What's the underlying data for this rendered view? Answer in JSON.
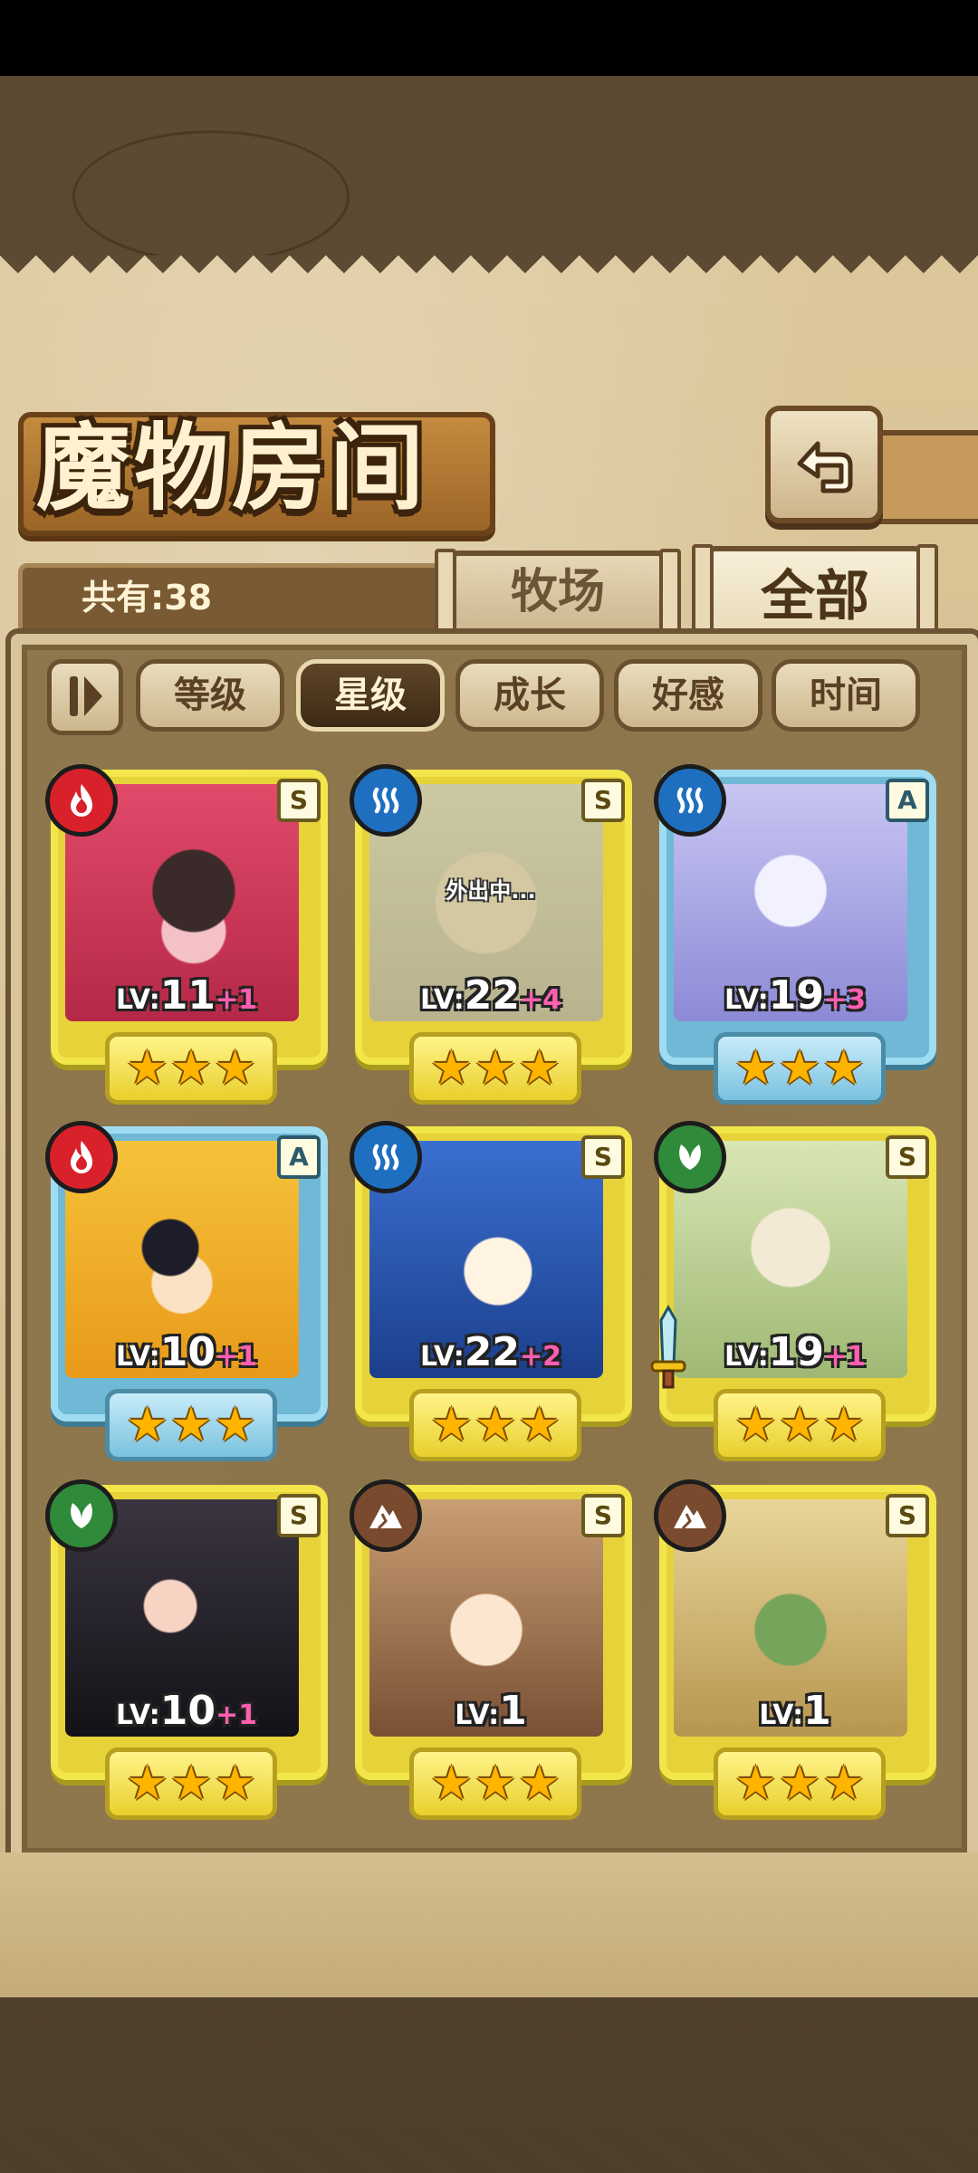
{
  "header": {
    "title": "魔物房间",
    "count_label": "共有:38"
  },
  "tabs": [
    {
      "label": "牧场",
      "selected": false
    },
    {
      "label": "全部",
      "selected": true
    }
  ],
  "sort": {
    "buttons": [
      {
        "label": "等级",
        "active": false
      },
      {
        "label": "星级",
        "active": true
      },
      {
        "label": "成长",
        "active": false
      },
      {
        "label": "好感",
        "active": false
      },
      {
        "label": "时间",
        "active": false
      }
    ]
  },
  "colors": {
    "fire": "#d8212a",
    "water": "#1f6fc0",
    "nature": "#2f8a3a",
    "earth": "#7a4a2e",
    "plus_pink": "#ff5fb0"
  },
  "monsters": [
    {
      "element": "fire-icon",
      "tier": "S",
      "lv_prefix": "LV:",
      "level": "11",
      "plus": "+1",
      "stars": 3,
      "frame": "gold",
      "status": ""
    },
    {
      "element": "water-icon",
      "tier": "S",
      "lv_prefix": "LV:",
      "level": "22",
      "plus": "+4",
      "stars": 3,
      "frame": "gold",
      "status": "外出中..."
    },
    {
      "element": "water-icon",
      "tier": "A",
      "lv_prefix": "LV:",
      "level": "19",
      "plus": "+3",
      "stars": 3,
      "frame": "blue",
      "status": ""
    },
    {
      "element": "fire-icon",
      "tier": "A",
      "lv_prefix": "LV:",
      "level": "10",
      "plus": "+1",
      "stars": 3,
      "frame": "blue",
      "status": ""
    },
    {
      "element": "water-icon",
      "tier": "S",
      "lv_prefix": "LV:",
      "level": "22",
      "plus": "+2",
      "stars": 3,
      "frame": "gold",
      "status": ""
    },
    {
      "element": "nature-icon",
      "tier": "S",
      "lv_prefix": "LV:",
      "level": "19",
      "plus": "+1",
      "stars": 3,
      "frame": "gold",
      "status": "",
      "equipped": "sword-icon"
    },
    {
      "element": "nature-icon",
      "tier": "S",
      "lv_prefix": "LV:",
      "level": "10",
      "plus": "+1",
      "stars": 3,
      "frame": "gold",
      "status": ""
    },
    {
      "element": "earth-icon",
      "tier": "S",
      "lv_prefix": "LV:",
      "level": "1",
      "plus": "",
      "stars": 3,
      "frame": "gold",
      "status": ""
    },
    {
      "element": "earth-icon",
      "tier": "S",
      "lv_prefix": "LV:",
      "level": "1",
      "plus": "",
      "stars": 3,
      "frame": "gold",
      "status": ""
    }
  ]
}
